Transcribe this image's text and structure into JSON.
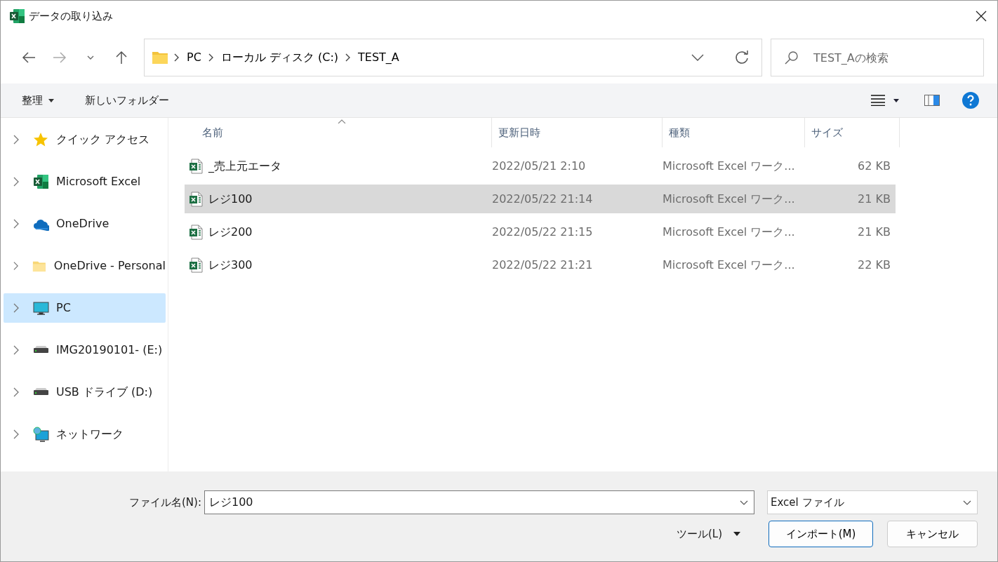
{
  "window": {
    "title": "データの取り込み"
  },
  "address": {
    "path": [
      "PC",
      "ローカル ディスク (C:)",
      "TEST_A"
    ]
  },
  "search": {
    "placeholder": "TEST_Aの検索"
  },
  "toolbar": {
    "organize": "整理",
    "new_folder": "新しいフォルダー"
  },
  "sidebar": {
    "items": [
      {
        "label": "クイック アクセス",
        "kind": "star",
        "selected": false
      },
      {
        "label": "Microsoft Excel",
        "kind": "excel",
        "selected": false
      },
      {
        "label": "OneDrive",
        "kind": "cloud",
        "selected": false
      },
      {
        "label": "OneDrive - Personal",
        "kind": "folder",
        "selected": false
      },
      {
        "label": "PC",
        "kind": "pc",
        "selected": true
      },
      {
        "label": "IMG20190101- (E:)",
        "kind": "drive",
        "selected": false
      },
      {
        "label": "USB ドライブ (D:)",
        "kind": "drive",
        "selected": false
      },
      {
        "label": "ネットワーク",
        "kind": "network",
        "selected": false
      }
    ]
  },
  "table": {
    "columns": [
      "名前",
      "更新日時",
      "種類",
      "サイズ"
    ],
    "rows": [
      {
        "name": "_売上元エータ",
        "date": "2022/05/21 2:10",
        "type": "Microsoft Excel ワーク...",
        "size": "62 KB",
        "selected": false
      },
      {
        "name": "レジ100",
        "date": "2022/05/22 21:14",
        "type": "Microsoft Excel ワーク...",
        "size": "21 KB",
        "selected": true
      },
      {
        "name": "レジ200",
        "date": "2022/05/22 21:15",
        "type": "Microsoft Excel ワーク...",
        "size": "21 KB",
        "selected": false
      },
      {
        "name": "レジ300",
        "date": "2022/05/22 21:21",
        "type": "Microsoft Excel ワーク...",
        "size": "22 KB",
        "selected": false
      }
    ]
  },
  "footer": {
    "file_name_label": "ファイル名(N):",
    "file_name": "レジ100",
    "file_type": "Excel ファイル",
    "tools": "ツール(L)",
    "import_button": "インポート(M)",
    "cancel_button": "キャンセル"
  }
}
